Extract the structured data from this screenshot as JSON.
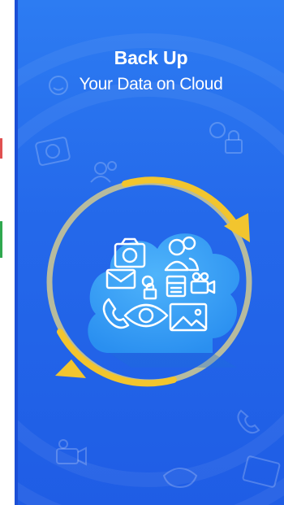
{
  "screen": {
    "title_bold": "Back Up",
    "title_regular": "Your Data on Cloud"
  },
  "colors": {
    "background_top": "#2d7cf2",
    "background_bottom": "#1f5de5",
    "cloud": "#3aa3f5",
    "arrow": "#f2c52e",
    "ring": "#b7bb9e",
    "icon_stroke": "#ffffff"
  },
  "icons": [
    "camera-icon",
    "users-icon",
    "envelope-icon",
    "settings-lock-icon",
    "calendar-icon",
    "video-camera-icon",
    "phone-icon",
    "eye-icon",
    "image-icon",
    "sync-arrow-icon",
    "cloud-icon"
  ]
}
